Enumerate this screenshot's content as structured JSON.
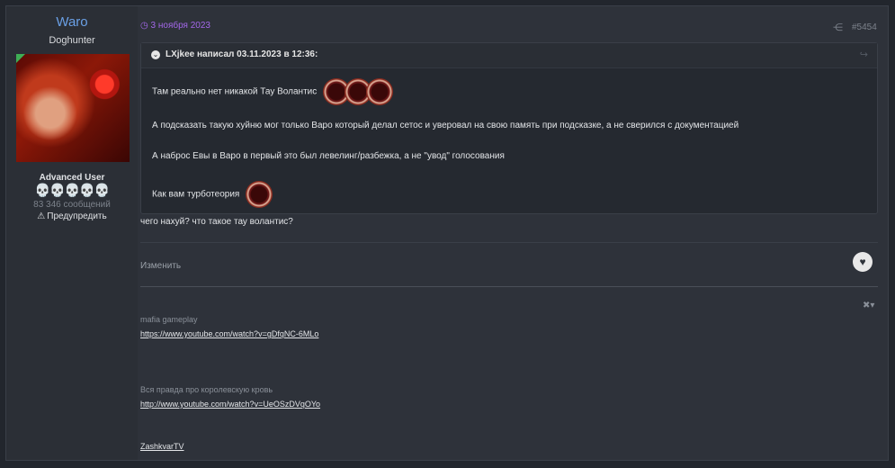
{
  "user": {
    "name": "Waro",
    "title": "Doghunter",
    "rank": "Advanced User",
    "skulls": "💀💀💀💀💀",
    "messages": "83 346 сообщений",
    "warn": "Предупредить"
  },
  "post": {
    "date": "3 ноября 2023",
    "number": "#5454",
    "quote": {
      "author_line": "LXjkee написал 03.11.2023 в 12:36:",
      "lines": [
        "Там реально нет никакой Тау Волантис",
        "А подсказать такую хуйню мог только Варо который делал сетос и уверовал на свою память при подсказке, а не сверился с документацией",
        "А наброс Евы в Варо в первый это был левелинг/разбежка, а не \"увод\" голосования",
        "Как вам турботеория"
      ]
    },
    "reply": "чего нахуй? что такое тау волантис?",
    "edit": "Изменить"
  },
  "signature": {
    "label1": "mafia gameplay",
    "link1": "https://www.youtube.com/watch?v=gDfqNC-6MLo",
    "label2": "Вся правда про королевскую кровь",
    "link2": "http://www.youtube.com/watch?v=UeOSzDVqOYo",
    "link3": "ZashkvarTV"
  },
  "colors": {
    "accent": "#6aa0e6",
    "date": "#a468ea",
    "background": "#22262d"
  }
}
